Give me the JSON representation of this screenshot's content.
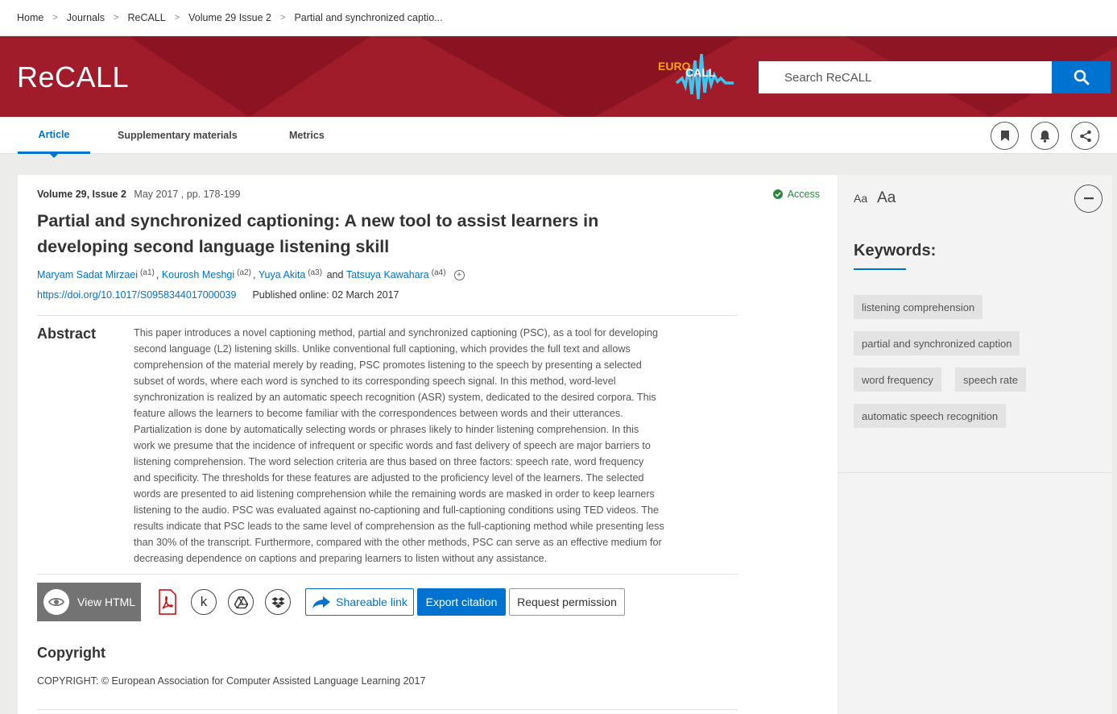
{
  "breadcrumb": [
    "Home",
    "Journals",
    "ReCALL",
    "Volume 29 Issue 2",
    "Partial and synchronized captio..."
  ],
  "header": {
    "brand": "ReCALL",
    "logo_text_1": "EURO",
    "logo_text_2": "CALL"
  },
  "search": {
    "placeholder": "Search ReCALL"
  },
  "tabs": [
    "Article",
    "Supplementary materials",
    "Metrics"
  ],
  "article": {
    "volume": "Volume 29, Issue 2",
    "date_pages": "May 2017 , pp. 178-199",
    "access": "Access",
    "title": "Partial and synchronized captioning: A new tool to assist learners in developing second language listening skill",
    "authors": [
      {
        "name": "Maryam Sadat Mirzaei",
        "aff": "(a1)",
        "sep": ","
      },
      {
        "name": "Kourosh Meshgi",
        "aff": "(a2)",
        "sep": ","
      },
      {
        "name": "Yuya Akita",
        "aff": "(a3)",
        "sep": "and"
      },
      {
        "name": "Tatsuya Kawahara",
        "aff": "(a4)",
        "sep": ""
      }
    ],
    "doi": "https://doi.org/10.1017/S0958344017000039",
    "published": "Published online: 02 March 2017",
    "abstract_heading": "Abstract",
    "abstract_lines": [
      "This paper introduces a novel captioning method, partial and synchronized captioning (PSC), as a tool for developing",
      "second language (L2) listening skills. Unlike conventional full captioning, which provides the full text and allows",
      "comprehension of the material merely by reading, PSC promotes listening to the speech by presenting a selected",
      "subset of words, where each word is synched to its corresponding speech signal. In this method, word-level",
      "synchronization is realized by an automatic speech recognition (ASR) system, dedicated to the desired corpora. This",
      "feature allows the learners to become familiar with the correspondences between words and their utterances.",
      "Partialization is done by automatically selecting words or phrases likely to hinder listening comprehension. In this",
      "work we presume that the incidence of infrequent or specific words and fast delivery of speech are major barriers to",
      "listening comprehension. The word selection criteria are thus based on three factors: speech rate, word frequency",
      "and specificity. The thresholds for these features are adjusted to the proficiency level of the learners. The selected",
      "words are presented to aid listening comprehension while the remaining words are masked in order to keep learners",
      "listening to the audio. PSC was evaluated against no-captioning and full-captioning conditions using TED videos. The",
      "results indicate that PSC leads to the same level of comprehension as the full-captioning method while presenting less",
      "than 30% of the transcript. Furthermore, compared with the other methods, PSC can serve as an effective medium for",
      "decreasing dependence on captions and preparing learners to listen without any assistance."
    ],
    "copyright_heading": "Copyright",
    "copyright_text": "COPYRIGHT: © European Association for Computer Assisted Language Learning 2017"
  },
  "actions": {
    "view_html": "View HTML",
    "shareable_link": "Shareable link",
    "export_citation": "Export citation",
    "request_permission": "Request permission",
    "kudos_letter": "k"
  },
  "sidebar": {
    "font_small": "Aa",
    "font_big": "Aa",
    "keywords_heading": "Keywords:",
    "keywords": [
      "listening comprehension",
      "partial and synchronized caption",
      "word frequency",
      "speech rate",
      "automatic speech recognition"
    ]
  },
  "colors": {
    "brand_red": "#a01c2b",
    "accent_blue": "#0072cf",
    "access_green": "#2e8540"
  }
}
